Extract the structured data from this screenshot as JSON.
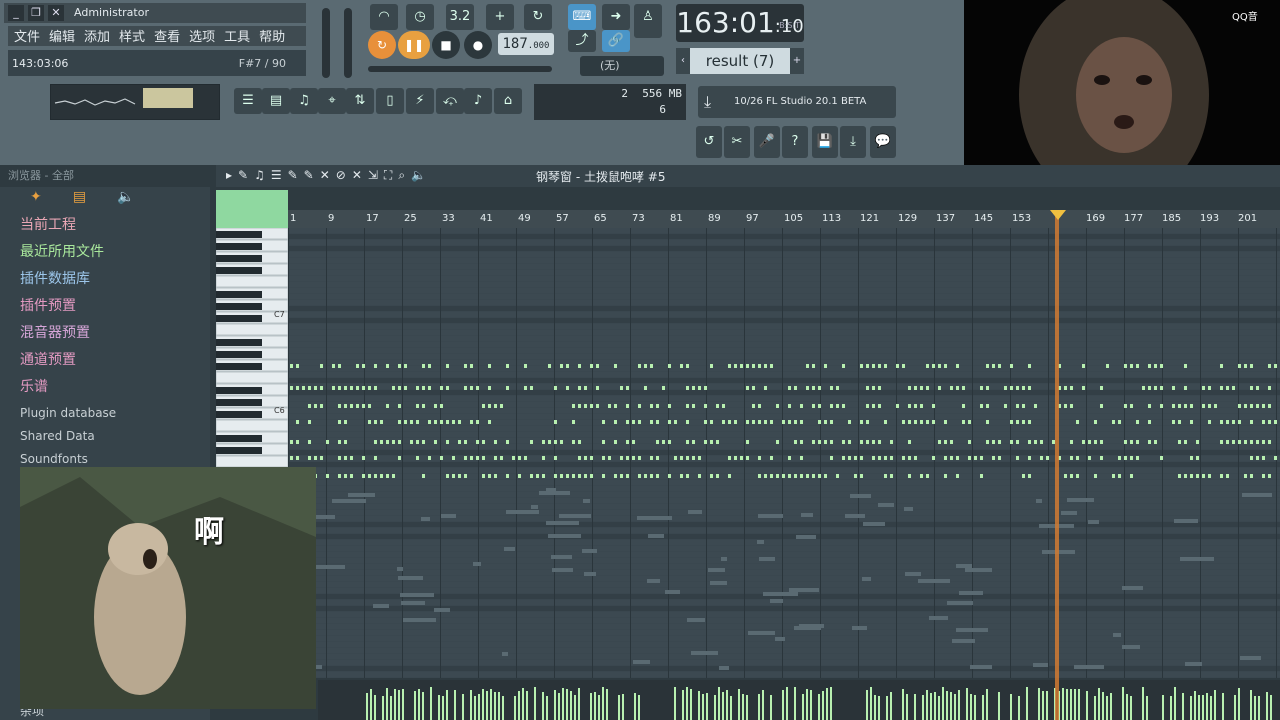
{
  "window": {
    "user": "Administrator"
  },
  "menu": [
    "文件",
    "编辑",
    "添加",
    "样式",
    "查看",
    "选项",
    "工具",
    "帮助"
  ],
  "hint": {
    "time": "143:03:06",
    "note": "F#7 / 90"
  },
  "transport": {
    "tempo": "187",
    "tempo_decimal": ".000",
    "time_main": "163:01",
    "time_sub": "10",
    "time_label": "B:S:T",
    "step_label": "3.2",
    "none_label": "(无)"
  },
  "pattern": {
    "label": "result (7)",
    "prev": "‹",
    "next": "+"
  },
  "cpu": {
    "voices": "2",
    "ram": "556 MB",
    "polyphony": "6"
  },
  "news": {
    "text": "10/26  FL Studio 20.1 BETA"
  },
  "browser": {
    "header": "浏览器 - 全部",
    "items": [
      {
        "label": "当前工程",
        "color": "#e8a6b4"
      },
      {
        "label": "最近所用文件",
        "color": "#a9e89c"
      },
      {
        "label": "插件数据库",
        "color": "#9cc6ea"
      },
      {
        "label": "插件预置",
        "color": "#e39ac2"
      },
      {
        "label": "混音器预置",
        "color": "#d6a6d8"
      },
      {
        "label": "通道预置",
        "color": "#e39ac2"
      },
      {
        "label": "乐谱",
        "color": "#e39ac2"
      },
      {
        "label": "Plugin database",
        "color": "#c8d0d4"
      },
      {
        "label": "Shared Data",
        "color": "#c8d0d4"
      },
      {
        "label": "Soundfonts",
        "color": "#c8d0d4"
      },
      {
        "label": "杂项",
        "color": "#c8d0d4"
      }
    ]
  },
  "piano_roll": {
    "title": "钢琴窗 - 土拨鼠咆哮 #5",
    "ruler": [
      "1",
      "9",
      "17",
      "25",
      "33",
      "41",
      "49",
      "57",
      "65",
      "73",
      "81",
      "89",
      "97",
      "105",
      "113",
      "121",
      "129",
      "137",
      "145",
      "153",
      "169",
      "177",
      "185",
      "193",
      "201"
    ],
    "keys": [
      "C7",
      "C6"
    ]
  },
  "overlay": {
    "gif_caption": "啊",
    "qq_label": "QQ音"
  },
  "colors": {
    "accent": "#4a95c8",
    "playhead": "#d07a32",
    "note": "#b8f0b0"
  }
}
